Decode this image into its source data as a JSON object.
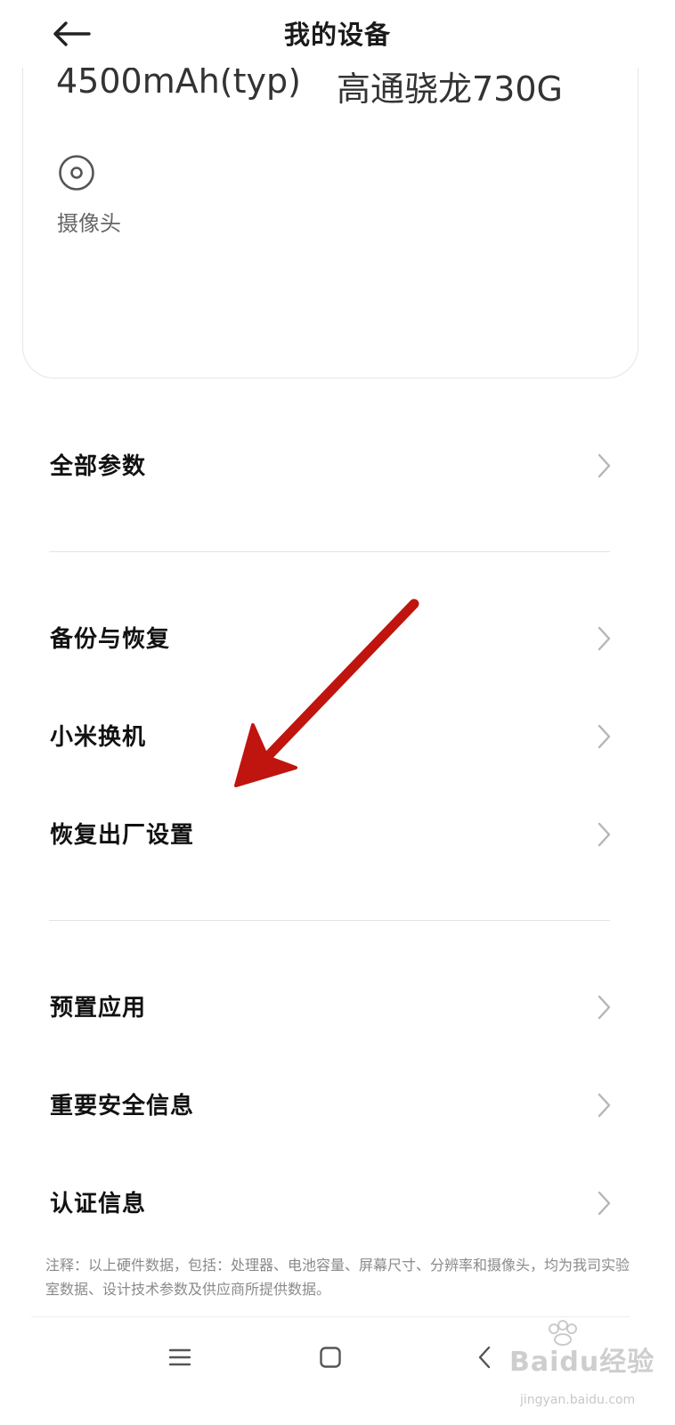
{
  "header": {
    "title": "我的设备",
    "back_icon": "arrow-left-icon"
  },
  "device_card": {
    "battery_spec": "4500mAh(typ)",
    "processor_spec": "高通骁龙730G",
    "camera": {
      "icon": "camera-lens-icon",
      "label": "摄像头"
    }
  },
  "menu": {
    "group1": [
      {
        "label": "全部参数"
      }
    ],
    "group2": [
      {
        "label": "备份与恢复"
      },
      {
        "label": "小米换机"
      },
      {
        "label": "恢复出厂设置"
      }
    ],
    "group3": [
      {
        "label": "预置应用"
      },
      {
        "label": "重要安全信息"
      },
      {
        "label": "认证信息"
      }
    ]
  },
  "footnote": "注释：以上硬件数据，包括：处理器、电池容量、屏幕尺寸、分辨率和摄像头，均为我司实验室数据、设计技术参数及供应商所提供数据。",
  "navbar": {
    "menu_icon": "menu-lines-icon",
    "home_icon": "home-square-icon",
    "back_icon": "back-chevron-icon"
  },
  "annotation": {
    "arrow_color": "#c0140f"
  },
  "watermark": {
    "text": "Baidu经验",
    "url": "jingyan.baidu.com"
  }
}
